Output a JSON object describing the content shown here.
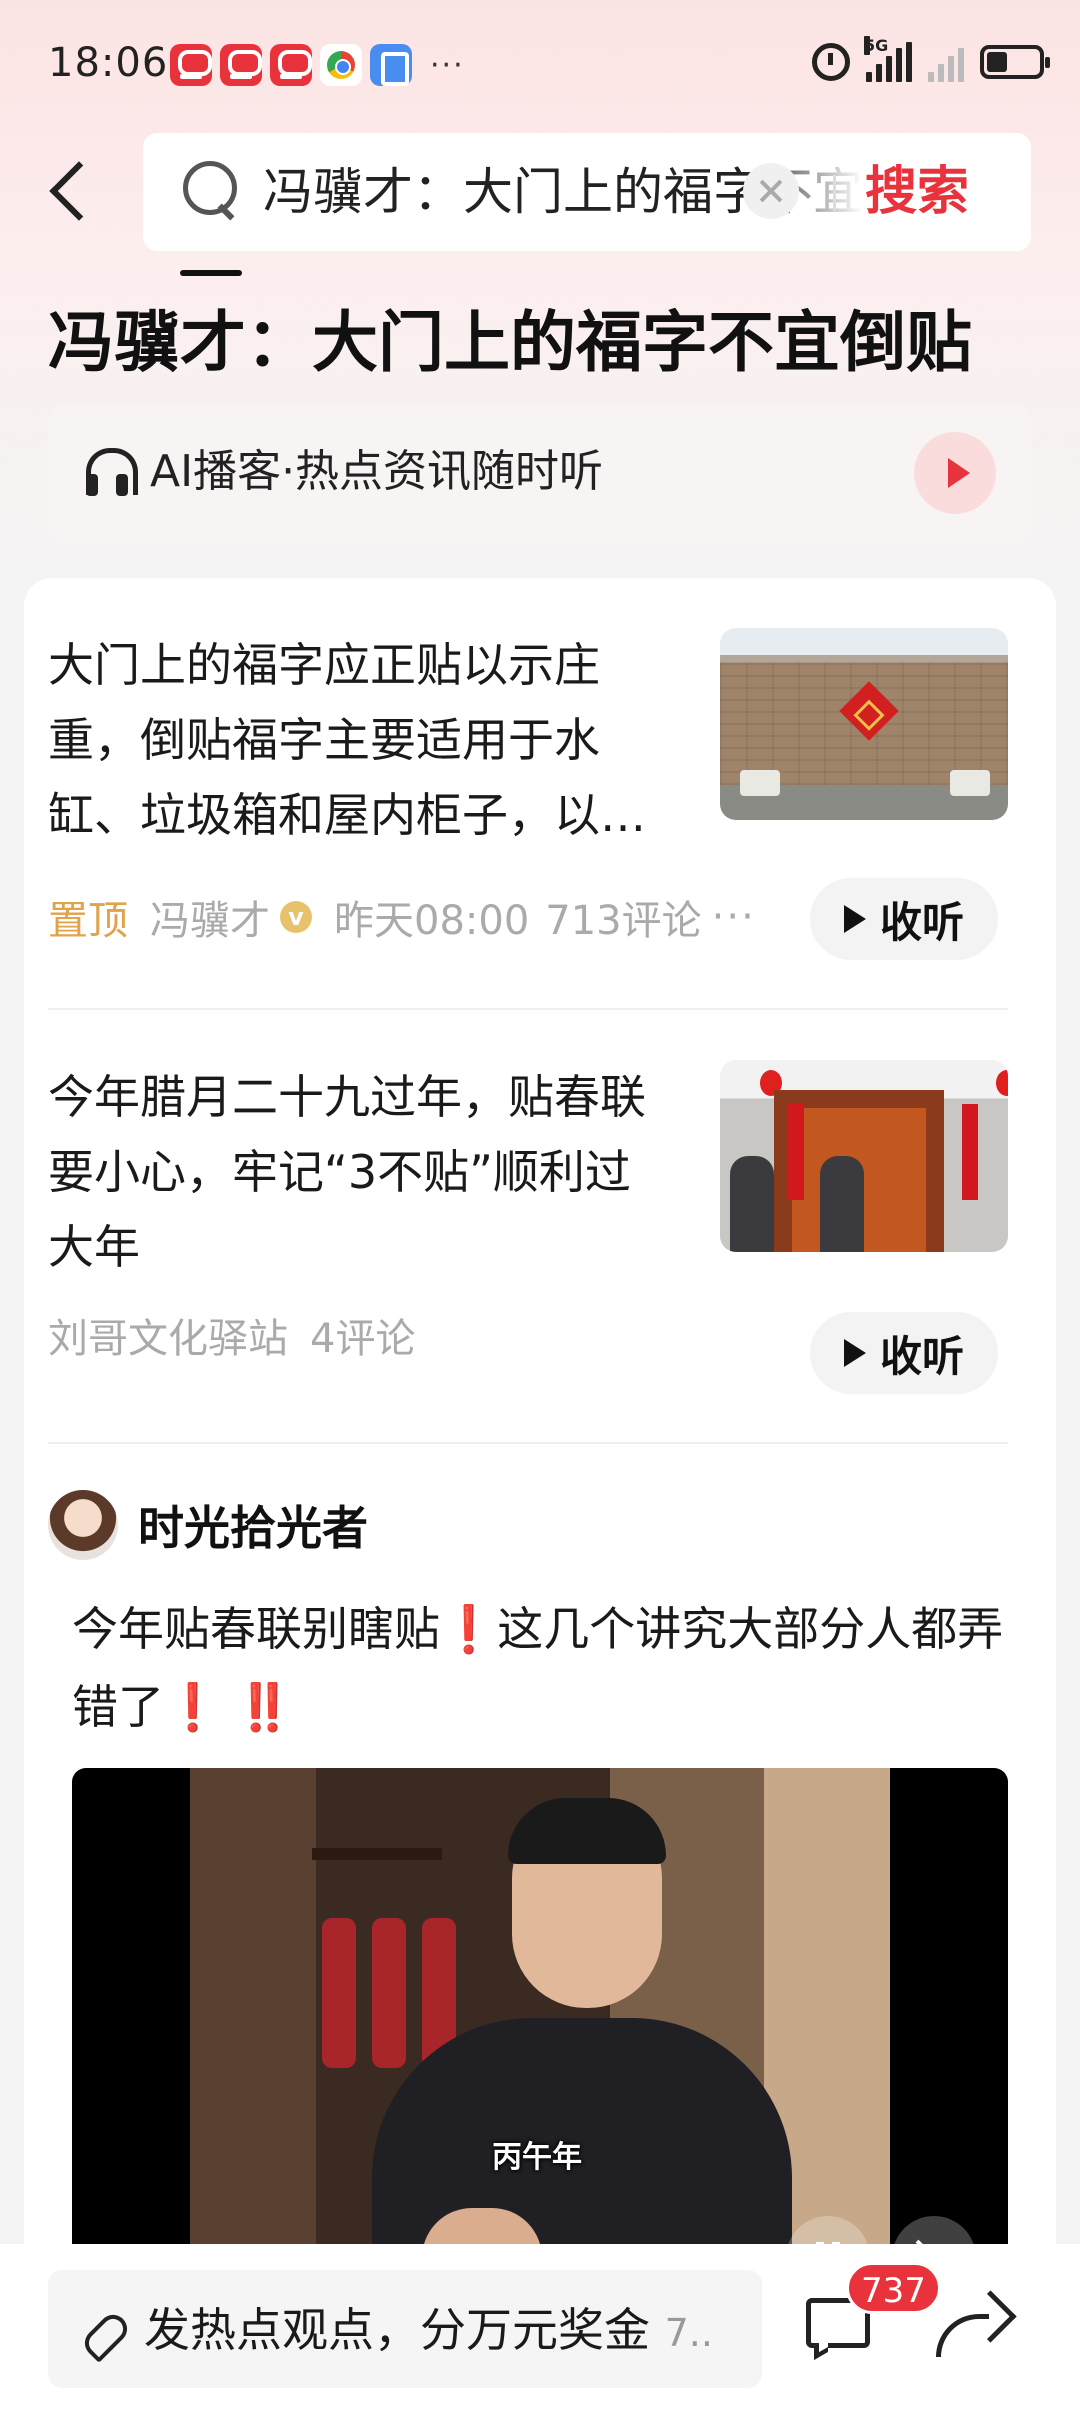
{
  "status_bar": {
    "time": "18:06",
    "network": "5G",
    "notification_apps": [
      "toutiao-icon",
      "toutiao-icon",
      "toutiao-icon",
      "chrome-icon",
      "security-icon"
    ],
    "more": "···"
  },
  "header": {
    "search_query": "冯骥才：大门上的福字不宜倒贴",
    "search_button": "搜索"
  },
  "page_title": "冯骥才：大门上的福字不宜倒贴",
  "podcast": {
    "label": "AI播客·热点资讯随时听"
  },
  "news": [
    {
      "title": "大门上的福字应正贴以示庄重，倒贴福字主要适用于水缸、垃圾箱和屋内柜子，以…",
      "tag": "置顶",
      "author": "冯骥才",
      "verified": "v",
      "time": "昨天08:00",
      "comments": "713评论",
      "more": "···",
      "listen_label": "收听"
    },
    {
      "title": "今年腊月二十九过年，贴春联要小心，牢记“3不贴”顺利过大年",
      "author": "刘哥文化驿站",
      "comments": "4评论",
      "listen_label": "收听"
    }
  ],
  "post": {
    "author": "时光拾光者",
    "text_a": "今年贴春联别瞎贴",
    "bang_1": "❗",
    "text_b": "这几个讲究大部分人都弄错了",
    "bang_2": "❗",
    "bang_3": "‼️",
    "video_caption": "丙午年"
  },
  "bottom_bar": {
    "comment_placeholder": "发热点观点，分万元奖金",
    "comment_suffix": "7..",
    "comment_count": "737"
  },
  "colors": {
    "accent": "#e8333c",
    "pinned": "#e0a24a"
  }
}
